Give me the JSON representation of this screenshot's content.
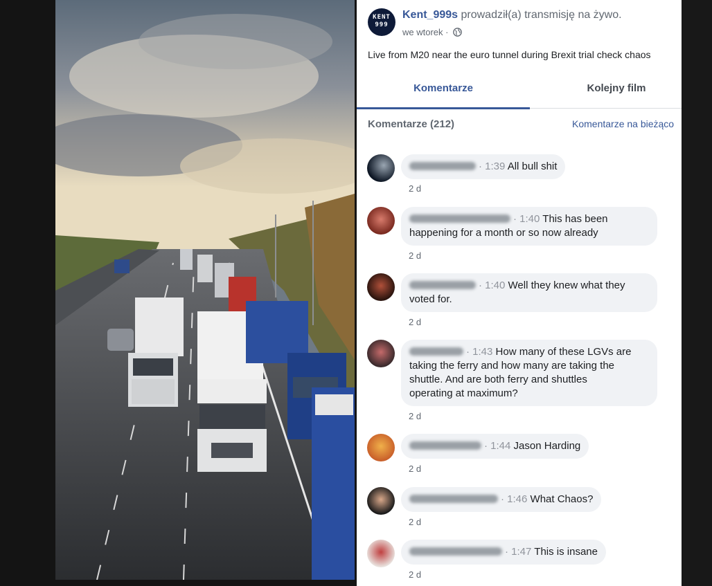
{
  "post": {
    "author": "Kent_999s",
    "action": "prowadził(a) transmisję na żywo.",
    "time": "we wtorek",
    "separator": "·",
    "privacy_icon": "globe-icon",
    "description": "Live from M20 near the euro tunnel during Brexit trial check chaos",
    "avatar_logo_lines": [
      "KENT",
      "999"
    ]
  },
  "tabs": {
    "comments": "Komentarze",
    "next_video": "Kolejny film"
  },
  "comments_section": {
    "count_label": "Komentarze (212)",
    "filter_label": "Komentarze na bieżąco"
  },
  "comments": [
    {
      "ts": "1:39",
      "text": "All bull shit",
      "age": "2 d"
    },
    {
      "ts": "1:40",
      "text": "This has been",
      "text2": "happening for a month or so now already",
      "age": "2 d"
    },
    {
      "ts": "1:40",
      "text": "Well they knew what they",
      "text2": "voted for.",
      "age": "2 d"
    },
    {
      "ts": "1:43",
      "text": "How many of these LGVs are",
      "text2": "taking the ferry and how many are taking the",
      "text3": "shuttle. And are both ferry and shuttles",
      "text4": "operating at maximum?",
      "age": "2 d"
    },
    {
      "ts": "1:44",
      "text": "Jason Harding",
      "age": "2 d"
    },
    {
      "ts": "1:46",
      "text": "What Chaos?",
      "age": "2 d"
    },
    {
      "ts": "1:47",
      "text": "This is insane",
      "age": "2 d"
    }
  ],
  "colors": {
    "link": "#385898",
    "bubble": "#f0f2f5",
    "secondary_text": "#606770"
  }
}
